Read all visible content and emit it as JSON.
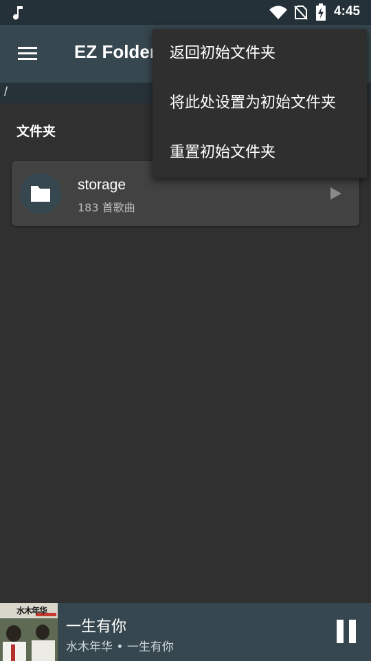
{
  "status_bar": {
    "time": "4:45",
    "icons": [
      "music-note-icon",
      "wifi-icon",
      "no-sim-icon",
      "battery-charging-icon"
    ]
  },
  "app_bar": {
    "title": "EZ Folder Player",
    "menu_icon": "hamburger-menu-icon"
  },
  "breadcrumb": {
    "path": "/"
  },
  "section": {
    "title": "文件夹"
  },
  "folders": [
    {
      "name": "storage",
      "count": "183 首歌曲",
      "icon": "folder-icon",
      "action_icon": "play-arrow-icon"
    }
  ],
  "popup_menu": {
    "items": [
      {
        "label": "返回初始文件夹"
      },
      {
        "label": "将此处设置为初始文件夹"
      },
      {
        "label": "重置初始文件夹"
      }
    ]
  },
  "now_playing": {
    "song": "一生有你",
    "subtitle": "水木年华 • 一生有你",
    "album_art_text": "水木年华",
    "control_icon": "pause-icon"
  },
  "colors": {
    "background": "#303030",
    "status_bar": "#253139",
    "app_bar": "#37474f",
    "card": "#424242",
    "menu": "#2f2f2f"
  }
}
